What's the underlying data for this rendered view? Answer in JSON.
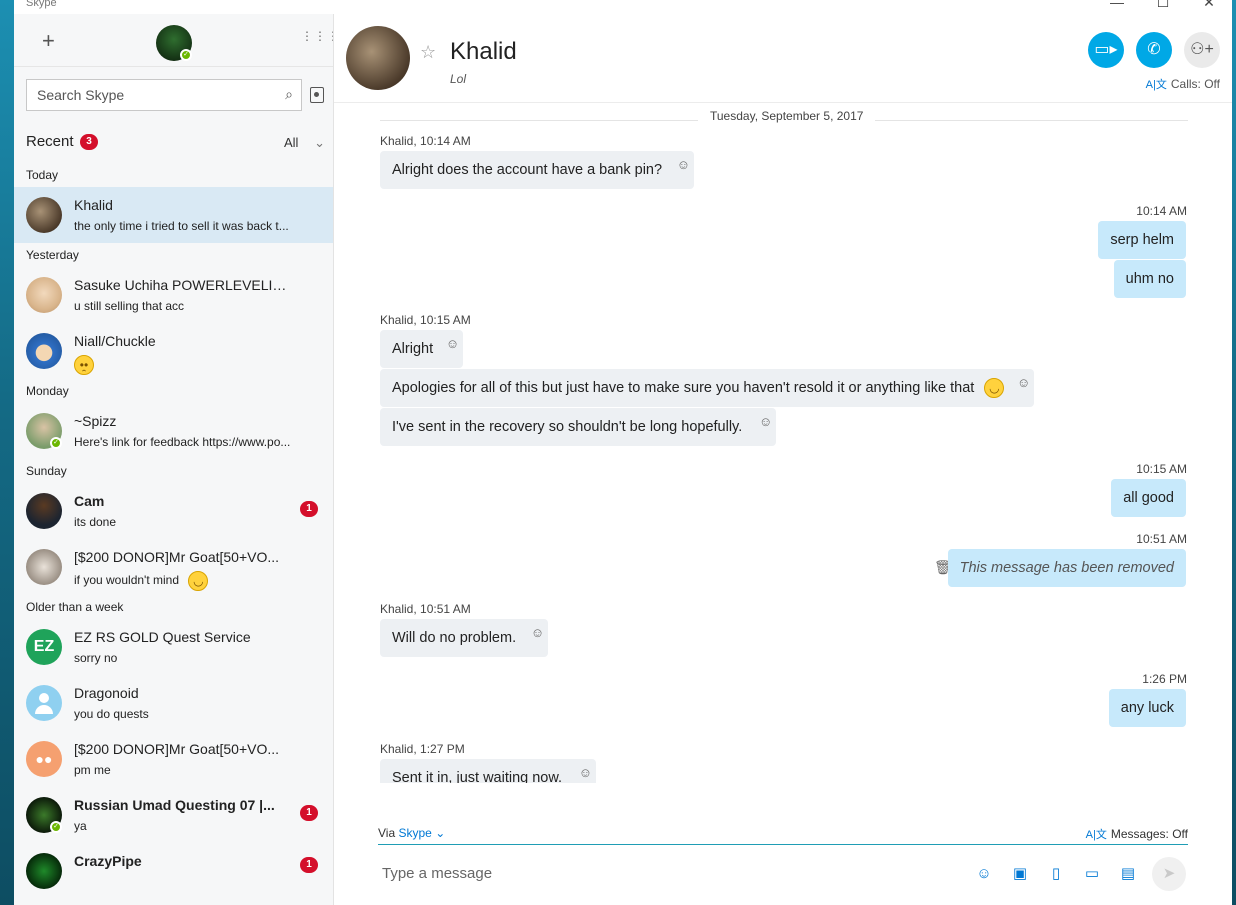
{
  "window": {
    "title": "Skype"
  },
  "sidebar": {
    "search_placeholder": "Search Skype",
    "recent_label": "Recent",
    "recent_count": "3",
    "filter_label": "All",
    "groups": {
      "today": "Today",
      "yesterday": "Yesterday",
      "monday": "Monday",
      "sunday": "Sunday",
      "older": "Older than a week"
    },
    "chats": [
      {
        "name": "Khalid",
        "preview": "the only time i tried to sell it was back t..."
      },
      {
        "name": "Sasuke Uchiha POWERLEVELIN...",
        "preview": "u still selling that acc"
      },
      {
        "name": "Niall/Chuckle",
        "preview": ""
      },
      {
        "name": "~Spizz",
        "preview": "Here's link for feedback https://www.po..."
      },
      {
        "name": "Cam",
        "preview": "its done",
        "badge": "1"
      },
      {
        "name": "[$200 DONOR]Mr Goat[50+VO...",
        "preview": "if you wouldn't mind"
      },
      {
        "name": "EZ RS GOLD Quest Service",
        "preview": "sorry no"
      },
      {
        "name": "Dragonoid",
        "preview": "you do quests"
      },
      {
        "name": "[$200 DONOR]Mr Goat[50+VO...",
        "preview": "pm me"
      },
      {
        "name": "Russian Umad Questing 07 |...",
        "preview": "ya",
        "badge": "1"
      },
      {
        "name": "CrazyPipe",
        "preview": "",
        "badge": "1"
      }
    ],
    "ez_avatar_text": "EZ"
  },
  "header": {
    "name": "Khalid",
    "mood": "Lol",
    "calls_label": "Calls: Off"
  },
  "conversation": {
    "date": "Tuesday, September 5, 2017",
    "items": [
      {
        "meta": "Khalid, 10:14 AM"
      },
      {
        "text": "Alright does the account have a bank pin?"
      },
      {
        "meta": "10:14 AM"
      },
      {
        "text": "serp helm"
      },
      {
        "text": "uhm no"
      },
      {
        "meta": "Khalid, 10:15 AM"
      },
      {
        "text": "Alright"
      },
      {
        "text": "Apologies for all of this but just have to make sure you haven't resold it or anything like that"
      },
      {
        "text": "I've sent in the recovery so shouldn't be long hopefully."
      },
      {
        "meta": "10:15 AM"
      },
      {
        "text": "all good"
      },
      {
        "meta": "10:51 AM"
      },
      {
        "text": "This message has been removed"
      },
      {
        "meta": "Khalid, 10:51 AM"
      },
      {
        "text": "Will do no problem."
      },
      {
        "meta": "1:26 PM"
      },
      {
        "text": "any luck"
      },
      {
        "meta": "Khalid, 1:27 PM"
      },
      {
        "text": "Sent it in, just waiting now."
      }
    ]
  },
  "composer": {
    "via_label": "Via",
    "via_service": "Skype",
    "messages_toggle": "Messages: Off",
    "placeholder": "Type a message"
  },
  "colors": {
    "accent": "#00a8e6",
    "outgoing_bubble": "#c7e9fb",
    "incoming_bubble": "#edf0f3",
    "badge": "#d40f2b",
    "presence": "#6bb700"
  }
}
